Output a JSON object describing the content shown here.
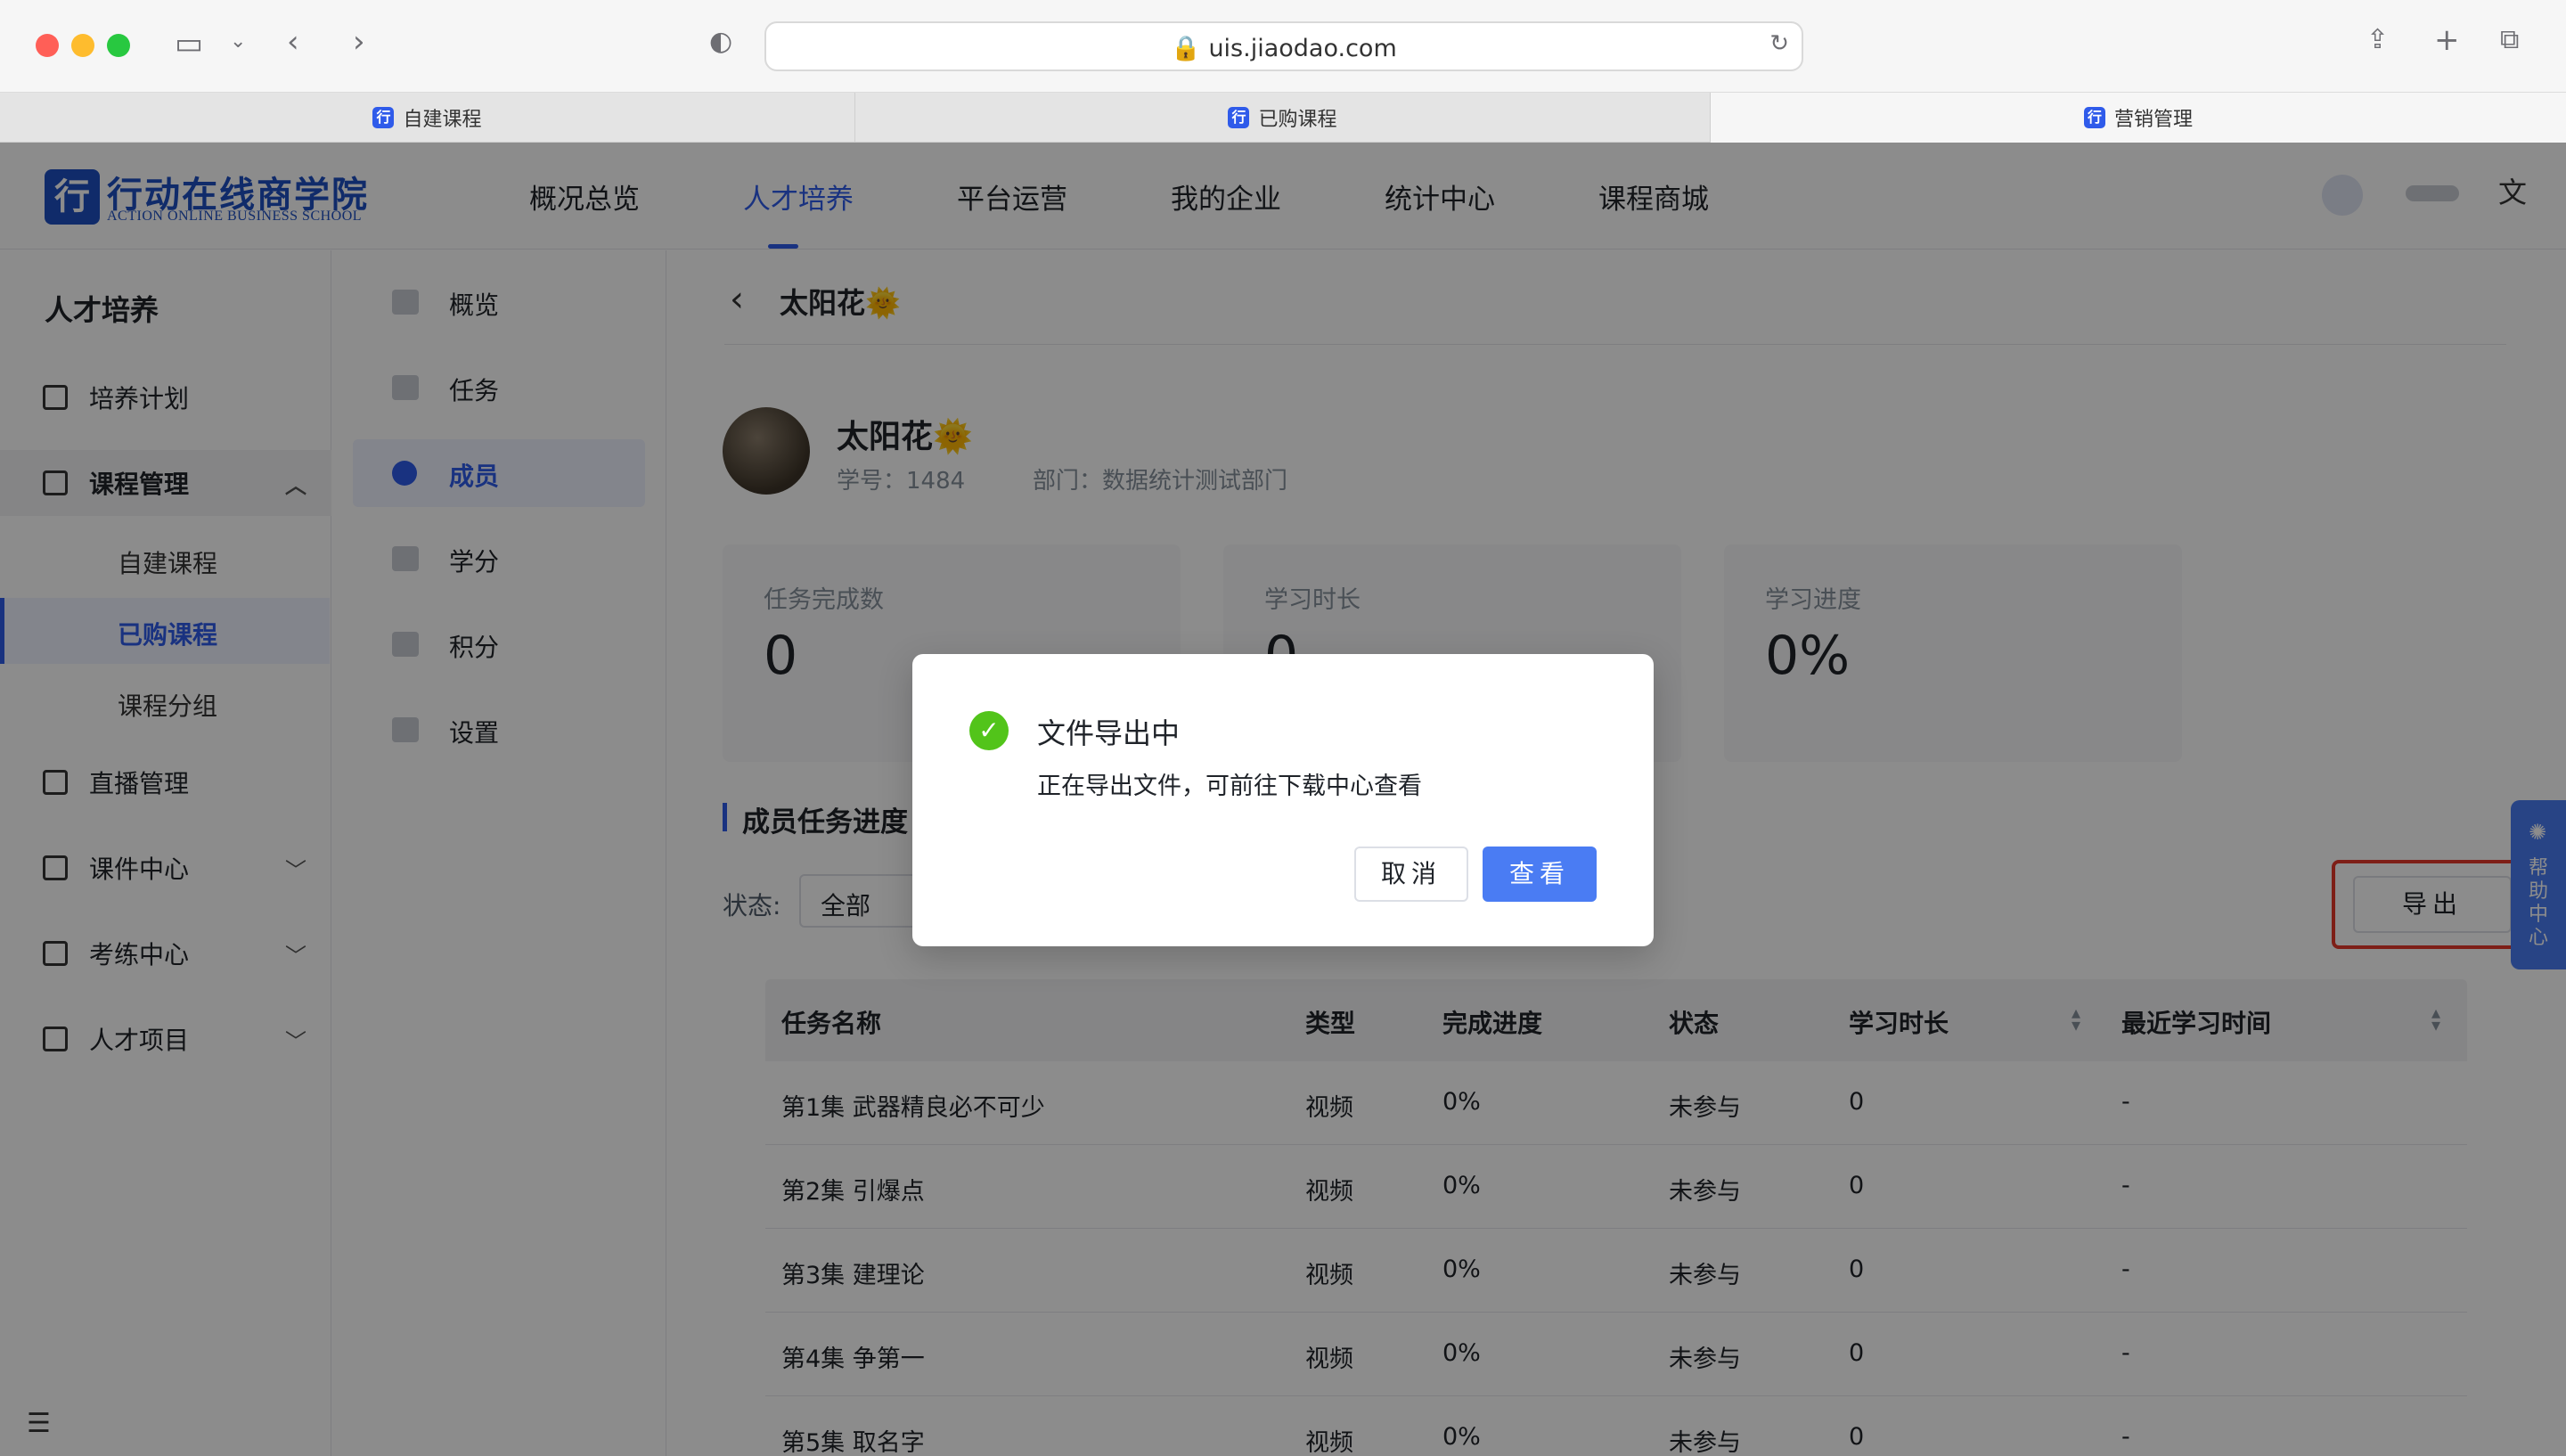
{
  "browser": {
    "url": "uis.jiaodao.com",
    "tabs": [
      "自建课程",
      "已购课程",
      "营销管理"
    ]
  },
  "header": {
    "logo_cn": "行动在线商学院",
    "logo_en": "ACTION ONLINE BUSINESS SCHOOL",
    "nav": [
      "概况总览",
      "人才培养",
      "平台运营",
      "我的企业",
      "统计中心",
      "课程商城"
    ],
    "active_nav": "人才培养"
  },
  "sidebar1": {
    "title": "人才培养",
    "items": {
      "plan": "培养计划",
      "course_mgmt": "课程管理",
      "sub_custom": "自建课程",
      "sub_bought": "已购课程",
      "sub_group": "课程分组",
      "live": "直播管理",
      "courseware": "课件中心",
      "exam": "考练中心",
      "talent": "人才项目"
    }
  },
  "sidebar2": {
    "items": [
      "概览",
      "任务",
      "成员",
      "学分",
      "积分",
      "设置"
    ],
    "selected": "成员"
  },
  "main": {
    "back_title": "太阳花🌞",
    "profile": {
      "name": "太阳花🌞",
      "student_id": "学号：1484",
      "department": "部门：数据统计测试部门"
    },
    "stats": [
      {
        "label": "任务完成数",
        "value": "0"
      },
      {
        "label": "学习时长",
        "value": "0"
      },
      {
        "label": "学习进度",
        "value": "0%"
      }
    ],
    "section_title": "成员任务进度",
    "filter_label": "状态:",
    "filter_value": "全部",
    "export_label": "导出",
    "table": {
      "headers": [
        "任务名称",
        "类型",
        "完成进度",
        "状态",
        "学习时长",
        "最近学习时间"
      ],
      "rows": [
        [
          "第1集 武器精良必不可少",
          "视频",
          "0%",
          "未参与",
          "0",
          "-"
        ],
        [
          "第2集 引爆点",
          "视频",
          "0%",
          "未参与",
          "0",
          "-"
        ],
        [
          "第3集 建理论",
          "视频",
          "0%",
          "未参与",
          "0",
          "-"
        ],
        [
          "第4集 争第一",
          "视频",
          "0%",
          "未参与",
          "0",
          "-"
        ],
        [
          "第5集 取名字",
          "视频",
          "0%",
          "未参与",
          "0",
          "-"
        ]
      ]
    }
  },
  "help": {
    "label": "帮助中心"
  },
  "dialog": {
    "title": "文件导出中",
    "message": "正在导出文件，可前往下载中心查看",
    "cancel": "取消",
    "view": "查看"
  }
}
